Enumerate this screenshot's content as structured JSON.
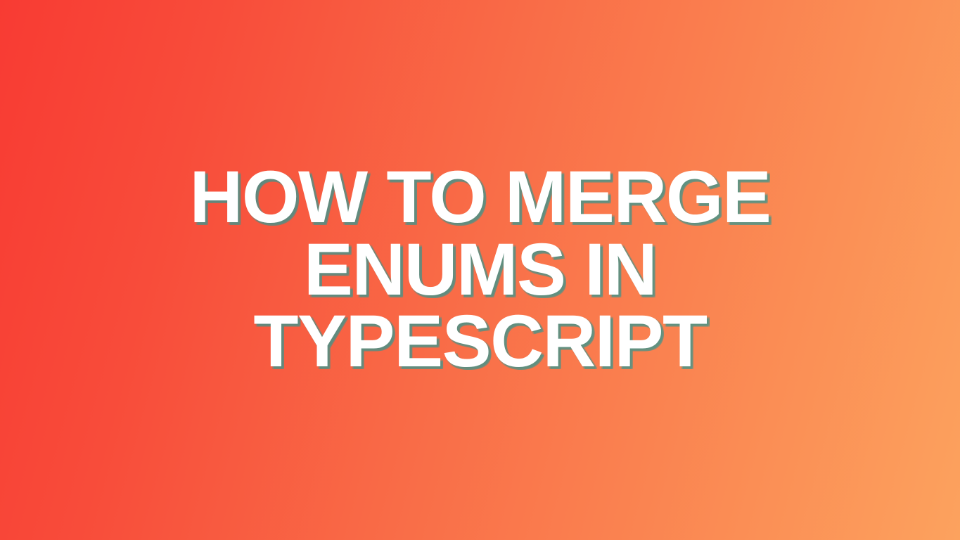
{
  "title": {
    "line1": "How to merge",
    "line2": "enums in",
    "line3": "TypeScript"
  },
  "colors": {
    "gradient_start": "#f83b33",
    "gradient_end": "#fca25e",
    "text": "#ffffff",
    "shadow": "rgba(60,150,140,0.55)"
  }
}
